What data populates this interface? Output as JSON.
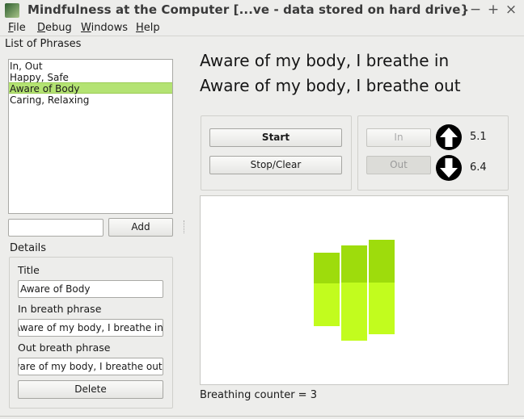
{
  "window": {
    "title": "Mindfulness at the Computer [...ve - data stored on hard drive}",
    "controls": {
      "minimize": "−",
      "maximize": "+",
      "close": "×"
    }
  },
  "menubar": {
    "items": [
      {
        "u": "F",
        "rest": "ile"
      },
      {
        "u": "D",
        "rest": "ebug"
      },
      {
        "u": "W",
        "rest": "indows"
      },
      {
        "u": "H",
        "rest": "elp"
      }
    ]
  },
  "phrases_panel": {
    "label": "List of Phrases",
    "items": [
      "In, Out",
      "Happy, Safe",
      "Aware of Body",
      "Caring, Relaxing"
    ],
    "selected_index": 2,
    "new_phrase_input_value": "",
    "add_label": "Add"
  },
  "details": {
    "label": "Details",
    "title_label": "Title",
    "title_value": "Aware of Body",
    "in_label": "In breath phrase",
    "in_value": "Aware of my body, I breathe in",
    "out_label": "Out breath phrase",
    "out_value": "Aware of my body, I breathe out",
    "delete_label": "Delete"
  },
  "breathing": {
    "phrase_in": "Aware of my body, I breathe in",
    "phrase_out": "Aware of my body, I breathe out",
    "start_label": "Start",
    "stop_label": "Stop/Clear",
    "in_label": "In",
    "out_label": "Out",
    "in_value": "5.1",
    "out_value": "6.4",
    "counter_text": "Breathing counter = 3",
    "colors": {
      "inhale": "#9edc0c",
      "exhale": "#c2fc1e"
    }
  }
}
